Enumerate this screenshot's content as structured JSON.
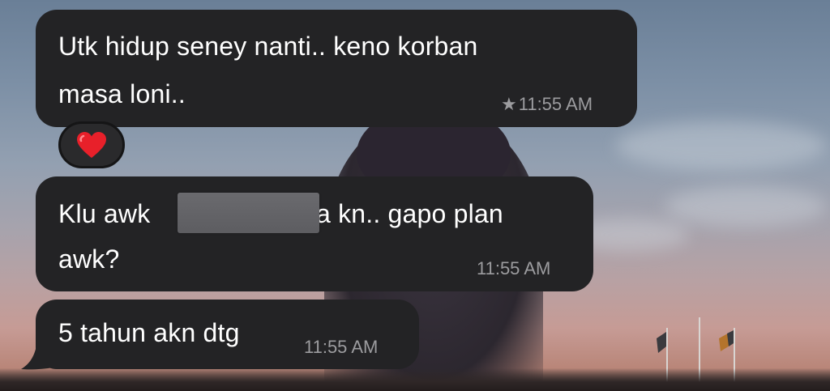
{
  "messages": [
    {
      "text_line1": "Utk hidup seney nanti.. keno korban",
      "text_line2": "masa loni..",
      "time": "11:55 AM",
      "starred": true,
      "reaction": "heart-emoji"
    },
    {
      "text_line1_start": "Klu awk",
      "text_line1_end": "a kn.. gapo plan",
      "text_line2": "awk?",
      "time": "11:55 AM",
      "redacted": true
    },
    {
      "text_line1": "5 tahun akn dtg",
      "time": "11:55 AM"
    }
  ],
  "icons": {
    "star": "star-icon",
    "reaction": "heart-icon"
  },
  "colors": {
    "bubble": "#232325",
    "text": "#ffffff",
    "timestamp": "#9c9c9f",
    "heart": "#e8202a"
  }
}
